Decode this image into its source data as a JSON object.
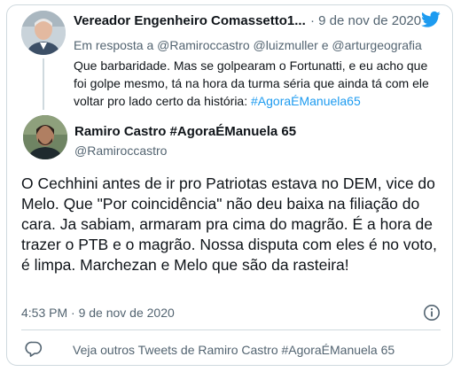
{
  "quoted_tweet": {
    "author_name": "Vereador Engenheiro Comassetto1...",
    "date": "· 9 de nov de 2020",
    "reply_prefix": "Em resposta a",
    "mentions": [
      "@Ramiroccastro",
      "@luizmuller",
      "@arturgeografia"
    ],
    "reply_joiner": "e",
    "text": "Que barbaridade. Mas se golpearam o Fortunatti, e eu acho que foi golpe mesmo, tá na hora da turma séria que ainda tá com ele voltar pro lado certo da história:",
    "hashtag": "#AgoraÉManuela65"
  },
  "main_tweet": {
    "author_name": "Ramiro Castro #AgoraÉManuela 65",
    "handle": "@Ramiroccastro",
    "text": "O Cechhini antes de ir pro Patriotas estava no DEM, vice do Melo. Que \"Por coincidência\" não deu baixa na filiação do cara. Ja sabiam, armaram pra cima do magrão. É a hora de trazer o PTB e o magrão. Nossa disputa com eles é no voto, é limpa. Marchezan e Melo que são da rasteira!",
    "timestamp": "4:53 PM · 9 de nov de 2020"
  },
  "footer": {
    "link_text": "Veja outros Tweets de Ramiro Castro #AgoraÉManuela 65"
  },
  "icons": {
    "brand": "twitter-bird-icon",
    "info": "info-icon",
    "reply": "chat-bubble-icon"
  },
  "colors": {
    "accent": "#1d9bf0",
    "secondary_text": "#536471",
    "border": "#cfd9de"
  }
}
